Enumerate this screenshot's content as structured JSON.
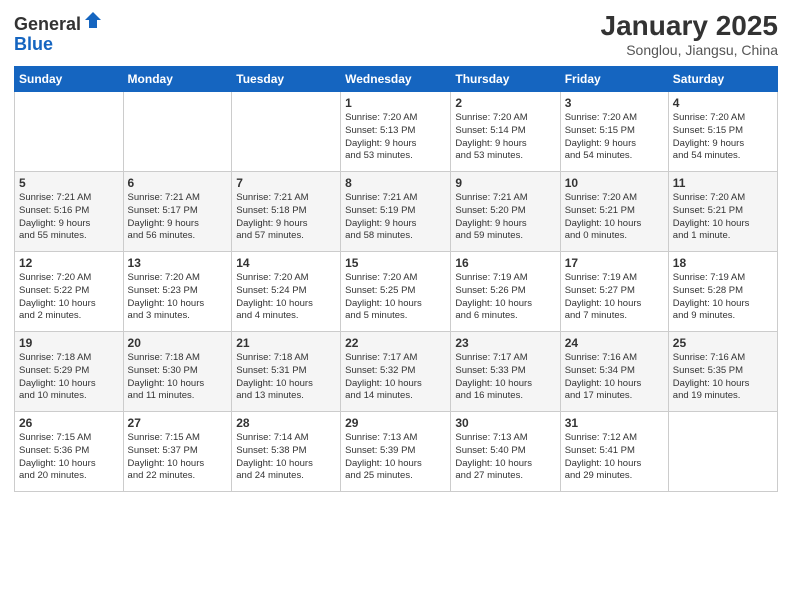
{
  "header": {
    "logo_general": "General",
    "logo_blue": "Blue",
    "month_title": "January 2025",
    "location": "Songlou, Jiangsu, China"
  },
  "days_of_week": [
    "Sunday",
    "Monday",
    "Tuesday",
    "Wednesday",
    "Thursday",
    "Friday",
    "Saturday"
  ],
  "weeks": [
    [
      {
        "day": "",
        "info": ""
      },
      {
        "day": "",
        "info": ""
      },
      {
        "day": "",
        "info": ""
      },
      {
        "day": "1",
        "info": "Sunrise: 7:20 AM\nSunset: 5:13 PM\nDaylight: 9 hours\nand 53 minutes."
      },
      {
        "day": "2",
        "info": "Sunrise: 7:20 AM\nSunset: 5:14 PM\nDaylight: 9 hours\nand 53 minutes."
      },
      {
        "day": "3",
        "info": "Sunrise: 7:20 AM\nSunset: 5:15 PM\nDaylight: 9 hours\nand 54 minutes."
      },
      {
        "day": "4",
        "info": "Sunrise: 7:20 AM\nSunset: 5:15 PM\nDaylight: 9 hours\nand 54 minutes."
      }
    ],
    [
      {
        "day": "5",
        "info": "Sunrise: 7:21 AM\nSunset: 5:16 PM\nDaylight: 9 hours\nand 55 minutes."
      },
      {
        "day": "6",
        "info": "Sunrise: 7:21 AM\nSunset: 5:17 PM\nDaylight: 9 hours\nand 56 minutes."
      },
      {
        "day": "7",
        "info": "Sunrise: 7:21 AM\nSunset: 5:18 PM\nDaylight: 9 hours\nand 57 minutes."
      },
      {
        "day": "8",
        "info": "Sunrise: 7:21 AM\nSunset: 5:19 PM\nDaylight: 9 hours\nand 58 minutes."
      },
      {
        "day": "9",
        "info": "Sunrise: 7:21 AM\nSunset: 5:20 PM\nDaylight: 9 hours\nand 59 minutes."
      },
      {
        "day": "10",
        "info": "Sunrise: 7:20 AM\nSunset: 5:21 PM\nDaylight: 10 hours\nand 0 minutes."
      },
      {
        "day": "11",
        "info": "Sunrise: 7:20 AM\nSunset: 5:21 PM\nDaylight: 10 hours\nand 1 minute."
      }
    ],
    [
      {
        "day": "12",
        "info": "Sunrise: 7:20 AM\nSunset: 5:22 PM\nDaylight: 10 hours\nand 2 minutes."
      },
      {
        "day": "13",
        "info": "Sunrise: 7:20 AM\nSunset: 5:23 PM\nDaylight: 10 hours\nand 3 minutes."
      },
      {
        "day": "14",
        "info": "Sunrise: 7:20 AM\nSunset: 5:24 PM\nDaylight: 10 hours\nand 4 minutes."
      },
      {
        "day": "15",
        "info": "Sunrise: 7:20 AM\nSunset: 5:25 PM\nDaylight: 10 hours\nand 5 minutes."
      },
      {
        "day": "16",
        "info": "Sunrise: 7:19 AM\nSunset: 5:26 PM\nDaylight: 10 hours\nand 6 minutes."
      },
      {
        "day": "17",
        "info": "Sunrise: 7:19 AM\nSunset: 5:27 PM\nDaylight: 10 hours\nand 7 minutes."
      },
      {
        "day": "18",
        "info": "Sunrise: 7:19 AM\nSunset: 5:28 PM\nDaylight: 10 hours\nand 9 minutes."
      }
    ],
    [
      {
        "day": "19",
        "info": "Sunrise: 7:18 AM\nSunset: 5:29 PM\nDaylight: 10 hours\nand 10 minutes."
      },
      {
        "day": "20",
        "info": "Sunrise: 7:18 AM\nSunset: 5:30 PM\nDaylight: 10 hours\nand 11 minutes."
      },
      {
        "day": "21",
        "info": "Sunrise: 7:18 AM\nSunset: 5:31 PM\nDaylight: 10 hours\nand 13 minutes."
      },
      {
        "day": "22",
        "info": "Sunrise: 7:17 AM\nSunset: 5:32 PM\nDaylight: 10 hours\nand 14 minutes."
      },
      {
        "day": "23",
        "info": "Sunrise: 7:17 AM\nSunset: 5:33 PM\nDaylight: 10 hours\nand 16 minutes."
      },
      {
        "day": "24",
        "info": "Sunrise: 7:16 AM\nSunset: 5:34 PM\nDaylight: 10 hours\nand 17 minutes."
      },
      {
        "day": "25",
        "info": "Sunrise: 7:16 AM\nSunset: 5:35 PM\nDaylight: 10 hours\nand 19 minutes."
      }
    ],
    [
      {
        "day": "26",
        "info": "Sunrise: 7:15 AM\nSunset: 5:36 PM\nDaylight: 10 hours\nand 20 minutes."
      },
      {
        "day": "27",
        "info": "Sunrise: 7:15 AM\nSunset: 5:37 PM\nDaylight: 10 hours\nand 22 minutes."
      },
      {
        "day": "28",
        "info": "Sunrise: 7:14 AM\nSunset: 5:38 PM\nDaylight: 10 hours\nand 24 minutes."
      },
      {
        "day": "29",
        "info": "Sunrise: 7:13 AM\nSunset: 5:39 PM\nDaylight: 10 hours\nand 25 minutes."
      },
      {
        "day": "30",
        "info": "Sunrise: 7:13 AM\nSunset: 5:40 PM\nDaylight: 10 hours\nand 27 minutes."
      },
      {
        "day": "31",
        "info": "Sunrise: 7:12 AM\nSunset: 5:41 PM\nDaylight: 10 hours\nand 29 minutes."
      },
      {
        "day": "",
        "info": ""
      }
    ]
  ]
}
